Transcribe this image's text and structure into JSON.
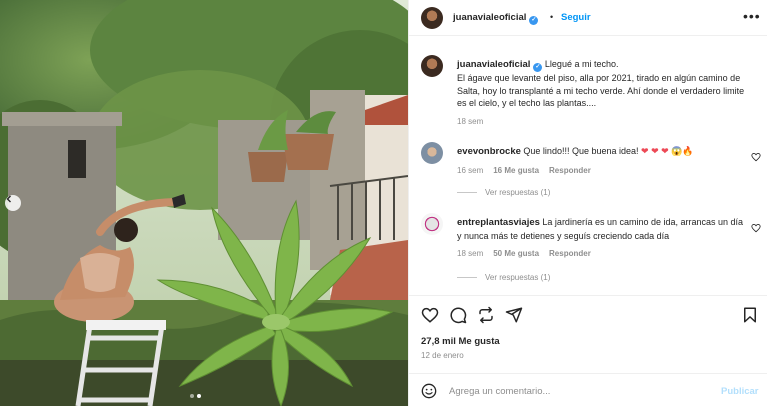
{
  "post": {
    "author": "juanavialeoficial",
    "follow_label": "Seguir",
    "separator": "•",
    "more_icon": "more-horizontal-icon",
    "caption_title": "Llegué a mi techo.",
    "caption_body": "El ágave que levante del piso, alla por 2021, tirado en algún camino de Salta, hoy lo transplanté a mi techo verde. Ahí donde el verdadero limite es el cielo, y el techo las plantas....",
    "caption_age": "18 sem",
    "likes": "27,8 mil Me gusta",
    "date": "12 de enero",
    "photo_slide_index": 2,
    "photo_slide_count": 2
  },
  "comments": [
    {
      "user": "evevonbrocke",
      "text": "Que lindo!!! Que buena idea!",
      "emoji": "❤ ❤ ❤ 😱🔥",
      "age": "16 sem",
      "likes": "16 Me gusta",
      "reply_label": "Responder",
      "view_replies": "Ver respuestas (1)"
    },
    {
      "user": "entreplantasviajes",
      "text": "La jardinería es un camino de ida, arrancas un día y nunca más te detienes y seguís creciendo cada día",
      "age": "18 sem",
      "likes": "50 Me gusta",
      "reply_label": "Responder",
      "view_replies": "Ver respuestas (1)"
    }
  ],
  "composer": {
    "placeholder": "Agrega un comentario...",
    "publish_label": "Publicar"
  },
  "colors": {
    "link_blue": "#0095f6",
    "verified": "#3897f0",
    "muted": "#8e8e8e",
    "publish_disabled": "#b2dffc"
  }
}
